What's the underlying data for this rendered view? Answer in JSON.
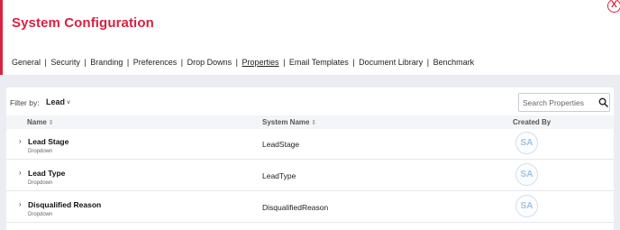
{
  "header": {
    "title": "System Configuration",
    "close_label": "X"
  },
  "nav": {
    "links": [
      {
        "label": "General",
        "active": false
      },
      {
        "label": "Security",
        "active": false
      },
      {
        "label": "Branding",
        "active": false
      },
      {
        "label": "Preferences",
        "active": false
      },
      {
        "label": "Drop Downs",
        "active": false
      },
      {
        "label": "Properties",
        "active": true
      },
      {
        "label": "Email Templates",
        "active": false
      },
      {
        "label": "Document Library",
        "active": false
      },
      {
        "label": "Benchmark",
        "active": false
      }
    ],
    "separator": "|"
  },
  "filter": {
    "label": "Filter by:",
    "value": "Lead"
  },
  "search": {
    "placeholder": "Search Properties",
    "value": "",
    "icon": "search-icon"
  },
  "table": {
    "columns": {
      "name": "Name",
      "system_name": "System Name",
      "created_by": "Created By"
    },
    "rows": [
      {
        "name": "Lead Stage",
        "type": "Dropdown",
        "system_name": "LeadStage",
        "created_by": "SA"
      },
      {
        "name": "Lead Type",
        "type": "Dropdown",
        "system_name": "LeadType",
        "created_by": "SA"
      },
      {
        "name": "Disqualified Reason",
        "type": "Dropdown",
        "system_name": "DisqualifiedReason",
        "created_by": "SA"
      }
    ]
  },
  "colors": {
    "accent": "#d8223f",
    "background": "#ebedf2",
    "avatar_text": "#9ec3e0"
  }
}
